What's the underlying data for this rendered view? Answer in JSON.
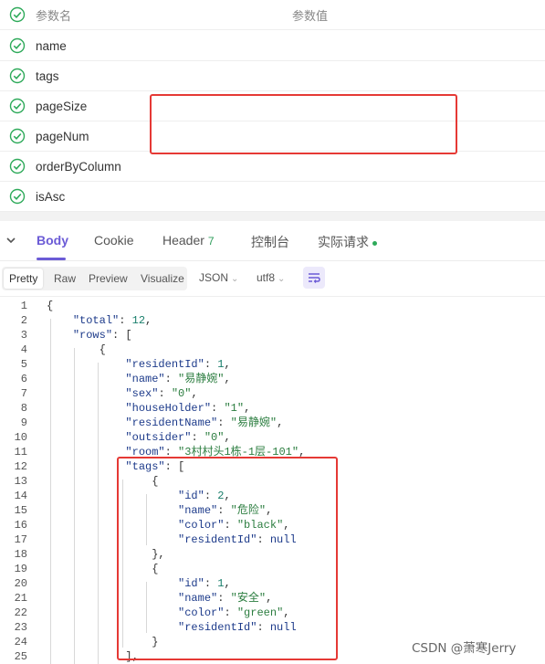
{
  "params": {
    "header": {
      "name_col": "参数名",
      "value_col": "参数值"
    },
    "rows": [
      "name",
      "tags",
      "pageSize",
      "pageNum",
      "orderByColumn",
      "isAsc"
    ]
  },
  "tabs": {
    "body": "Body",
    "cookie": "Cookie",
    "header": "Header",
    "header_count": "7",
    "console": "控制台",
    "actual_request": "实际请求"
  },
  "toolbar": {
    "pretty": "Pretty",
    "raw": "Raw",
    "preview": "Preview",
    "visualize": "Visualize",
    "format": "JSON",
    "encoding": "utf8"
  },
  "code_lines": [
    "{",
    "    \"total\": 12,",
    "    \"rows\": [",
    "        {",
    "            \"residentId\": 1,",
    "            \"name\": \"易静婉\",",
    "            \"sex\": \"0\",",
    "            \"houseHolder\": \"1\",",
    "            \"residentName\": \"易静婉\",",
    "            \"outsider\": \"0\",",
    "            \"room\": \"3村村头1栋-1层-101\",",
    "            \"tags\": [",
    "                {",
    "                    \"id\": 2,",
    "                    \"name\": \"危险\",",
    "                    \"color\": \"black\",",
    "                    \"residentId\": null",
    "                },",
    "                {",
    "                    \"id\": 1,",
    "                    \"name\": \"安全\",",
    "                    \"color\": \"green\",",
    "                    \"residentId\": null",
    "                }",
    "            ],"
  ],
  "watermark": "CSDN @萧寒Jerry",
  "colors": {
    "accent": "#6b5bd6",
    "check": "#2eaa5a",
    "highlight": "#e53935"
  },
  "icons": {
    "check": "check-circle-icon",
    "collapse": "chevron-down-icon",
    "wrap": "word-wrap-icon"
  }
}
